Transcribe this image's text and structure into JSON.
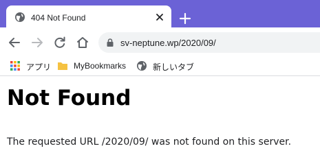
{
  "tab": {
    "title": "404 Not Found",
    "favicon": "globe-icon",
    "close": "close-icon"
  },
  "toolbar": {
    "back": "arrow-left-icon",
    "forward": "arrow-right-icon",
    "reload": "reload-icon",
    "home": "home-icon",
    "url": "sv-neptune.wp/2020/09/"
  },
  "bookmarks": [
    {
      "label": "アプリ",
      "icon": "apps-grid-icon"
    },
    {
      "label": "MyBookmarks",
      "icon": "folder-icon"
    },
    {
      "label": "新しいタブ",
      "icon": "globe-icon"
    }
  ],
  "page": {
    "heading": "Not Found",
    "message": "The requested URL /2020/09/ was not found on this server."
  },
  "colors": {
    "titlebar": "#6b62d6",
    "omnibox": "#f1f3f4",
    "folder": "#f5c242"
  }
}
